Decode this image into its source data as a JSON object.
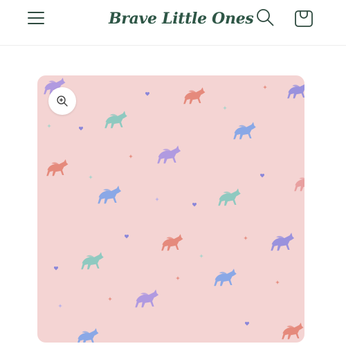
{
  "header": {
    "brand": "Brave Little Ones",
    "menu_icon": "hamburger-menu-icon",
    "search_icon": "search-icon",
    "cart_icon": "shopping-bag-icon"
  },
  "product": {
    "image_pattern": "pastel-unicorns-on-pink",
    "zoom_icon": "zoom-in-icon"
  },
  "colors": {
    "brand": "#2e5646",
    "image_background": "#f4d4d3",
    "unicorn_palette": [
      "#e58a7c",
      "#8fc9c0",
      "#8aa8e6",
      "#b09ae0",
      "#e8a0a0"
    ]
  }
}
